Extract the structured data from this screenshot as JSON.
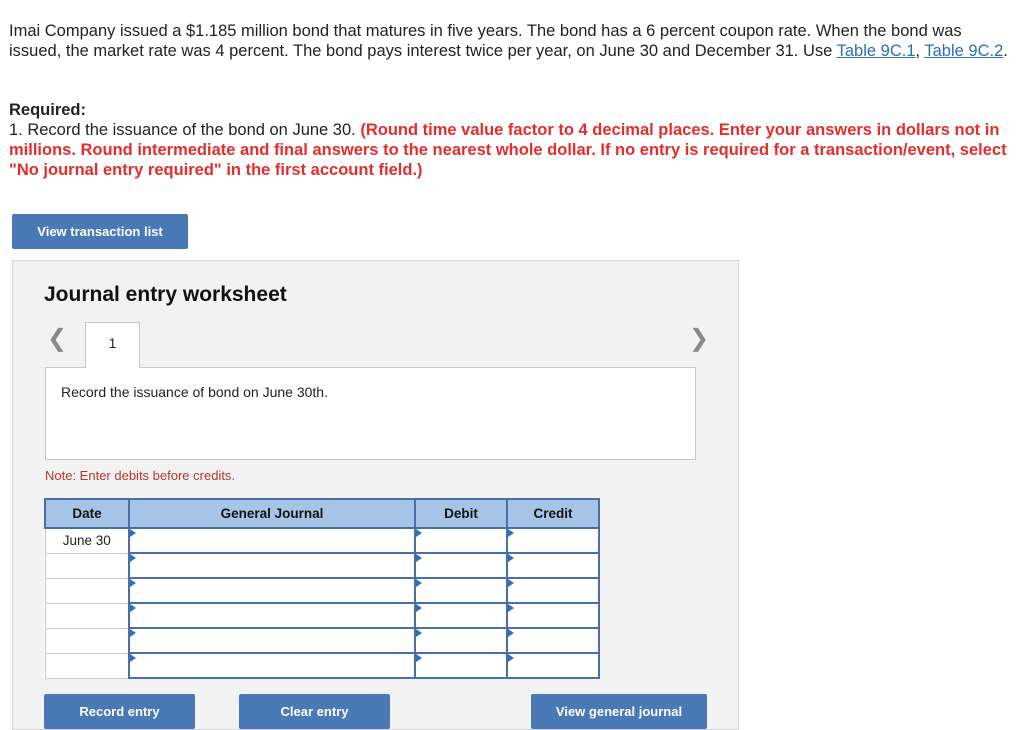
{
  "problem": {
    "text_before_links": "Imai Company issued a $1.185 million bond that matures in five years. The bond has a 6 percent coupon rate. When the bond was issued, the market rate was 4 percent. The bond pays interest twice per year, on June 30 and December 31. Use ",
    "link1": "Table 9C.1",
    "separator": ", ",
    "link2": "Table 9C.2",
    "text_after_links": "."
  },
  "required": {
    "heading": "Required:",
    "item_text": "1. Record the issuance of the bond on June 30. ",
    "instructions": "(Round time value factor to 4 decimal places. Enter your answers in dollars not in millions. Round intermediate and final answers to the nearest whole dollar. If no entry is required for a transaction/event, select \"No journal entry required\" in the first account field.)"
  },
  "buttons": {
    "view_transaction_list": "View transaction list",
    "record_entry": "Record entry",
    "clear_entry": "Clear entry",
    "view_general_journal": "View general journal"
  },
  "worksheet": {
    "title": "Journal entry worksheet",
    "prev_icon": "chevron-left-icon",
    "next_icon": "chevron-right-icon",
    "active_tab": "1",
    "instruction": "Record the issuance of bond on June 30th.",
    "note": "Note: Enter debits before credits."
  },
  "journal": {
    "headers": {
      "date": "Date",
      "general_journal": "General Journal",
      "debit": "Debit",
      "credit": "Credit"
    },
    "rows": [
      {
        "date": "June 30",
        "account": "",
        "debit": "",
        "credit": ""
      },
      {
        "date": "",
        "account": "",
        "debit": "",
        "credit": ""
      },
      {
        "date": "",
        "account": "",
        "debit": "",
        "credit": ""
      },
      {
        "date": "",
        "account": "",
        "debit": "",
        "credit": ""
      },
      {
        "date": "",
        "account": "",
        "debit": "",
        "credit": ""
      },
      {
        "date": "",
        "account": "",
        "debit": "",
        "credit": ""
      }
    ]
  },
  "colors": {
    "accent_button": "#4a79b8",
    "instruction_red": "#e52d2d",
    "link_blue": "#2a6db8",
    "table_header": "#a6c5e6",
    "table_border": "#4a6fa5"
  }
}
